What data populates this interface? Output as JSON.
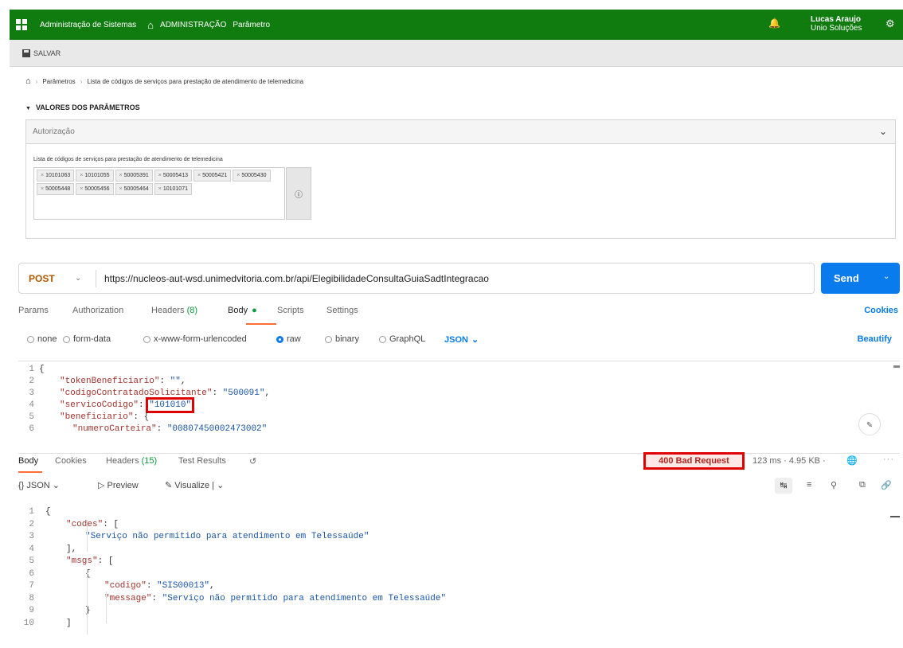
{
  "admin": {
    "app_name": "Administração de Sistemas",
    "section": "ADMINISTRAÇÃO",
    "page": "Parâmetro",
    "user_name": "Lucas Araujo",
    "user_company": "Unio Soluções",
    "save_label": "SALVAR",
    "breadcrumb": [
      "Parâmetros",
      "Lista de códigos de serviços para prestação de atendimento de telemedicina"
    ],
    "section_header": "VALORES DOS PARÂMETROS",
    "panel_title": "Autorização",
    "field_label": "Lista de códigos de serviços para prestação de atendimento de telemedicina",
    "tags": [
      "10101063",
      "10101055",
      "50005391",
      "50005413",
      "50005421",
      "50005430",
      "50005448",
      "50005456",
      "50005464",
      "10101071"
    ],
    "brand_color": "#107c10"
  },
  "request": {
    "method": "POST",
    "url": "https://nucleos-aut-wsd.unimedvitoria.com.br/api/ElegibilidadeConsultaGuiaSadtIntegracao",
    "send_label": "Send",
    "tabs": {
      "params": "Params",
      "authorization": "Authorization",
      "headers": "Headers",
      "headers_count": "(8)",
      "body": "Body",
      "scripts": "Scripts",
      "settings": "Settings",
      "cookies": "Cookies"
    },
    "body_options": {
      "none": "none",
      "form_data": "form-data",
      "urlencoded": "x-www-form-urlencoded",
      "raw": "raw",
      "binary": "binary",
      "graphql": "GraphQL",
      "format": "JSON",
      "beautify": "Beautify"
    },
    "code_lines": [
      {
        "n": "1",
        "text": "{"
      },
      {
        "n": "2",
        "key": "\"tokenBeneficiario\"",
        "value": "\"\"",
        "tail": ","
      },
      {
        "n": "3",
        "key": "\"codigoContratadoSolicitante\"",
        "value": "\"500091\"",
        "tail": ","
      },
      {
        "n": "4",
        "key": "\"servicoCodigo\"",
        "value": "\"101010\"",
        "tail": ","
      },
      {
        "n": "5",
        "key": "\"beneficiario\"",
        "value": "{",
        "tail": ""
      },
      {
        "n": "6",
        "key": "\"numeroCarteira\"",
        "value": "\"00807450002473002\"",
        "tail": ""
      }
    ],
    "accent_color": "#097bed"
  },
  "response": {
    "tabs": {
      "body": "Body",
      "cookies": "Cookies",
      "headers": "Headers",
      "headers_count": "(15)",
      "test_results": "Test Results"
    },
    "status": "400 Bad Request",
    "time": "123 ms",
    "size": "4.95 KB",
    "format": "JSON",
    "preview": "Preview",
    "visualize": "Visualize",
    "code_lines": [
      {
        "n": "1",
        "text": "{"
      },
      {
        "n": "2",
        "key": "\"codes\"",
        "value": "[",
        "tail": ""
      },
      {
        "n": "3",
        "text": "\"Serviço não permitido para atendimento em Telessaúde\""
      },
      {
        "n": "4",
        "text": "],"
      },
      {
        "n": "5",
        "key": "\"msgs\"",
        "value": "[",
        "tail": ""
      },
      {
        "n": "6",
        "text": "{"
      },
      {
        "n": "7",
        "key": "\"codigo\"",
        "value": "\"SIS00013\"",
        "tail": ","
      },
      {
        "n": "8",
        "key": "\"message\"",
        "value": "\"Serviço não permitido para atendimento em Telessaúde\"",
        "tail": ""
      },
      {
        "n": "9",
        "text": "}"
      },
      {
        "n": "10",
        "text": "]"
      }
    ]
  }
}
